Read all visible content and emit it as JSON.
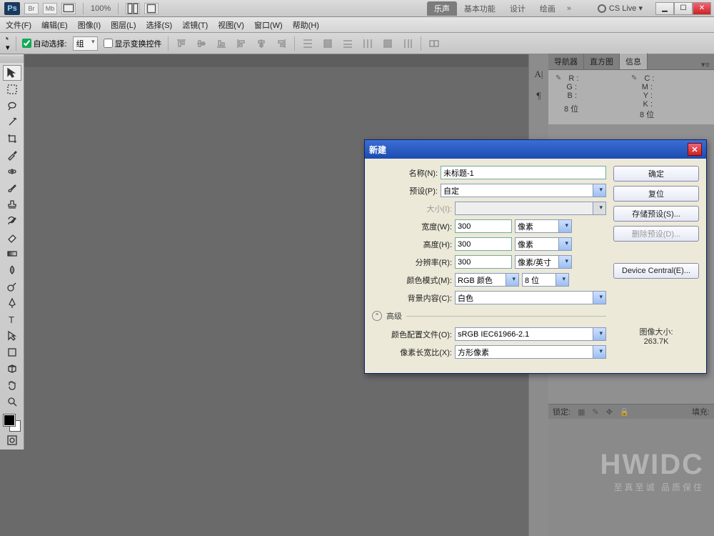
{
  "app_bar": {
    "ps": "Ps",
    "br": "Br",
    "mb": "Mb",
    "zoom": "100%",
    "cslive": "CS Live ▾"
  },
  "workspaces": {
    "items": [
      "乐声",
      "基本功能",
      "设计",
      "绘画"
    ],
    "chev": "»"
  },
  "win": {
    "min": "▁",
    "max": "☐",
    "close": "✕"
  },
  "menu": [
    "文件(F)",
    "编辑(E)",
    "图像(I)",
    "图层(L)",
    "选择(S)",
    "滤镜(T)",
    "视图(V)",
    "窗口(W)",
    "帮助(H)"
  ],
  "options": {
    "auto_select": "自动选择:",
    "group": "组",
    "show_transform": "显示变换控件"
  },
  "panel_tabs": [
    "导航器",
    "直方图",
    "信息"
  ],
  "info": {
    "left_labels": [
      "R :",
      "G :",
      "B :"
    ],
    "right_labels": [
      "C :",
      "M :",
      "Y :",
      "K :"
    ],
    "bits": "8 位"
  },
  "lower": {
    "lock": "锁定:",
    "fill": "填充:"
  },
  "watermark": {
    "big": "HWIDC",
    "small": "至真至诚  品质保住"
  },
  "dialog": {
    "title": "新建",
    "name_lbl": "名称(N):",
    "name_val": "未标题-1",
    "preset_lbl": "预设(P):",
    "preset_val": "自定",
    "size_lbl": "大小(I):",
    "width_lbl": "宽度(W):",
    "width_val": "300",
    "width_unit": "像素",
    "height_lbl": "高度(H):",
    "height_val": "300",
    "height_unit": "像素",
    "res_lbl": "分辨率(R):",
    "res_val": "300",
    "res_unit": "像素/英寸",
    "mode_lbl": "颜色模式(M):",
    "mode_val": "RGB 颜色",
    "depth_val": "8 位",
    "bg_lbl": "背景内容(C):",
    "bg_val": "白色",
    "advanced": "高级",
    "profile_lbl": "颜色配置文件(O):",
    "profile_val": "sRGB IEC61966-2.1",
    "aspect_lbl": "像素长宽比(X):",
    "aspect_val": "方形像素",
    "buttons": {
      "ok": "确定",
      "reset": "复位",
      "save": "存储预设(S)...",
      "delete": "删除预设(D)...",
      "dc": "Device Central(E)..."
    },
    "imgsize_lbl": "图像大小:",
    "imgsize_val": "263.7K"
  }
}
